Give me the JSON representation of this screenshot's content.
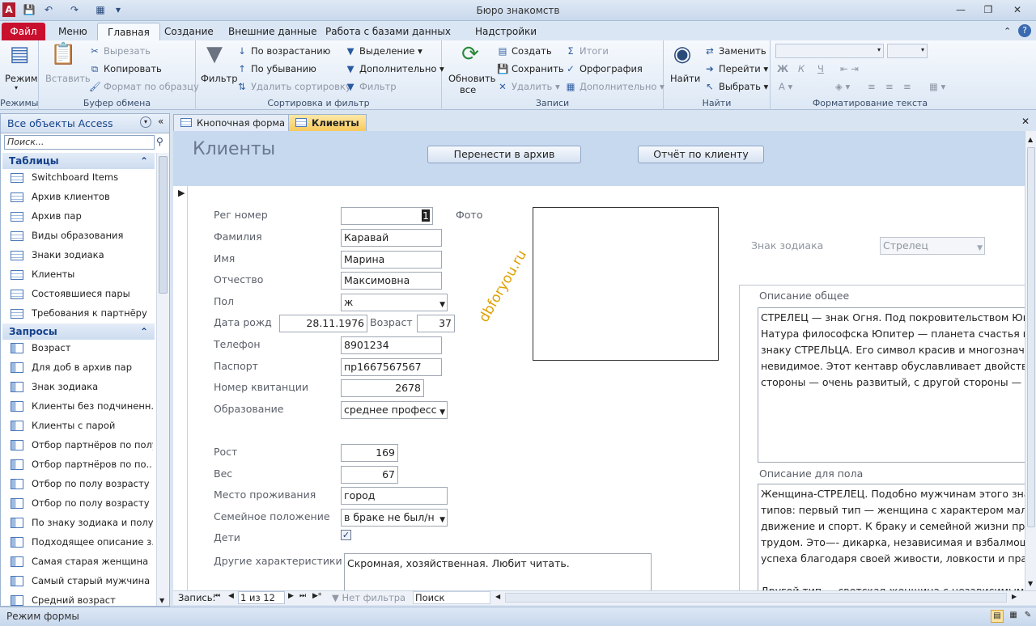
{
  "window": {
    "title": "Бюро знакомств"
  },
  "ribbon_tabs": [
    "Файл",
    "Меню",
    "Главная",
    "Создание",
    "Внешние данные",
    "Работа с базами данных",
    "Надстройки"
  ],
  "ribbon": {
    "views": {
      "label": "Режимы",
      "view": "Режим"
    },
    "clipboard": {
      "label": "Буфер обмена",
      "paste": "Вставить",
      "cut": "Вырезать",
      "copy": "Копировать",
      "format": "Формат по образцу"
    },
    "sort": {
      "label": "Сортировка и фильтр",
      "filter": "Фильтр",
      "asc": "По возрастанию",
      "desc": "По убыванию",
      "clear": "Удалить сортировку",
      "selection": "Выделение",
      "advanced": "Дополнительно",
      "toggle": "Фильтр"
    },
    "records": {
      "label": "Записи",
      "refresh": "Обновить",
      "refresh2": "все",
      "new": "Создать",
      "save": "Сохранить",
      "delete": "Удалить",
      "totals": "Итоги",
      "spelling": "Орфография",
      "more": "Дополнительно"
    },
    "find": {
      "label": "Найти",
      "find": "Найти",
      "replace": "Заменить",
      "goto": "Перейти",
      "select": "Выбрать"
    },
    "text": {
      "label": "Форматирование текста"
    }
  },
  "nav": {
    "header": "Все объекты Access",
    "search_placeholder": "Поиск...",
    "tables_label": "Таблицы",
    "tables": [
      "Switchboard Items",
      "Архив клиентов",
      "Архив пар",
      "Виды образования",
      "Знаки зодиака",
      "Клиенты",
      "Состоявшиеся пары",
      "Требования к партнёру"
    ],
    "queries_label": "Запросы",
    "queries": [
      "Возраст",
      "Для  доб в архив пар",
      "Знак зодиака",
      "Клиенты без подчиненн...",
      "Клиенты с парой",
      "Отбор партнёров по полу",
      "Отбор партнёров по по...",
      "Отбор по полу  возрасту ...",
      "Отбор по полу  возрасту ...",
      "По знаку зодиака и полу",
      "Подходящее описание з...",
      "Самая старая женщина",
      "Самый старый мужчина",
      "Средний возраст"
    ]
  },
  "doc_tabs": [
    "Кнопочная форма",
    "Клиенты"
  ],
  "form": {
    "title": "Клиенты",
    "btn_archive": "Перенести в архив",
    "btn_report": "Отчёт по клиенту",
    "labels": {
      "reg": "Рег номер",
      "surname": "Фамилия",
      "name": "Имя",
      "patronymic": "Отчество",
      "sex": "Пол",
      "birth": "Дата рожд",
      "age": "Возраст",
      "phone": "Телефон",
      "passport": "Паспорт",
      "receipt": "Номер квитанции",
      "education": "Образование",
      "height": "Рост",
      "weight": "Вес",
      "residence": "Место проживания",
      "marital": "Семейное положение",
      "children": "Дети",
      "other": "Другие характеристики",
      "photo": "Фото",
      "zodiac": "Знак зодиака",
      "desc_general": "Описание общее",
      "desc_sex": "Описание для пола"
    },
    "values": {
      "reg": "1",
      "surname": "Каравай",
      "name": "Марина",
      "patronymic": "Максимовна",
      "sex": "ж",
      "birth": "28.11.1976",
      "age": "37",
      "phone": "8901234",
      "passport": "пр1667567567",
      "receipt": "2678",
      "education": "среднее професс",
      "height": "169",
      "weight": "67",
      "residence": "город",
      "marital": "в браке не был/н",
      "other": "Скромная, хозяйственная. Любит читать.",
      "zodiac": "Стрелец"
    },
    "children_checked": true,
    "watermark": "dbforyou.ru",
    "desc_general_lines": [
      "СТРЕЛЕЦ — знак Огня. Под покровительством Юпи",
      "Натура философска Юпитер — планета счастья и б",
      "знаку СТРЕЛЬЦА. Его символ красив и многозначит",
      "невидимое. Этот кентавр обуславливает двойствен",
      "стороны — очень развитый, с другой стороны — пр"
    ],
    "desc_sex_lines": [
      "Женщина-СТРЕЛЕЦ. Подобно мужчинам этого знак",
      "типов: первый тип — женщина с характером мальч",
      "движение и спорт. К браку и семейной жизни прис",
      "трудом. Это—- дикарка, независимая и взбалмошн",
      "успеха благодаря своей  живости, ловкости и практ",
      "",
      "Другой тип — светская женщина с независимым ск"
    ]
  },
  "record_nav": {
    "label": "Запись:",
    "position": "1 из 12",
    "filter": "Нет фильтра",
    "search": "Поиск"
  },
  "status": {
    "text": "Режим формы"
  }
}
